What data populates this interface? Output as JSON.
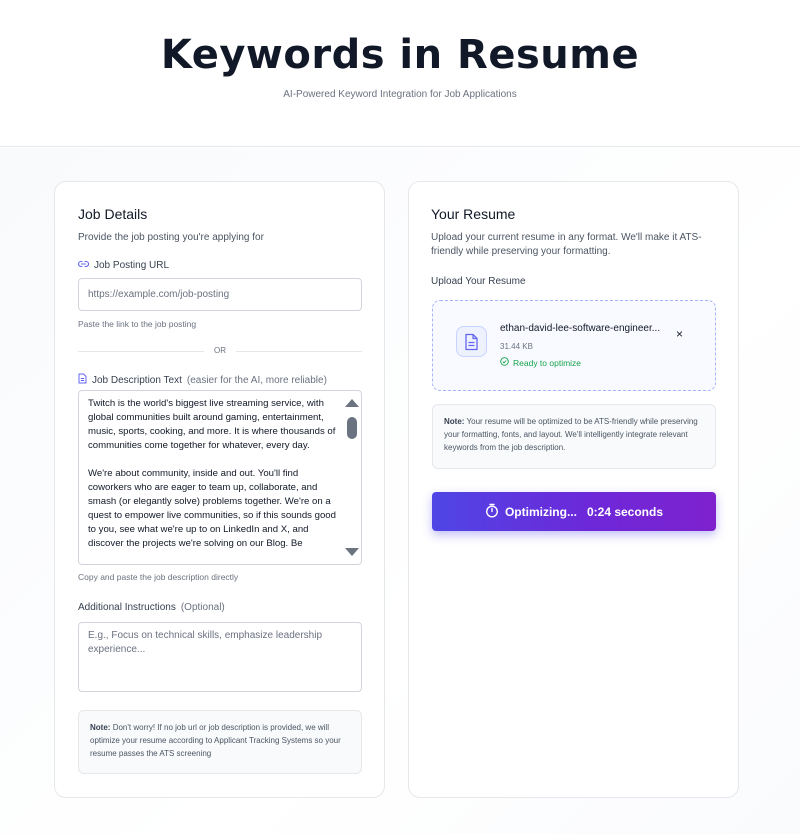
{
  "header": {
    "title": "Keywords in Resume",
    "subtitle": "AI-Powered Keyword Integration for Job Applications"
  },
  "job_details": {
    "title": "Job Details",
    "description": "Provide the job posting you're applying for",
    "url_label": "Job Posting URL",
    "url_placeholder": "https://example.com/job-posting",
    "url_value": "",
    "url_hint": "Paste the link to the job posting",
    "or_text": "OR",
    "jd_label": "Job Description Text",
    "jd_label_note": "(easier for the AI, more reliable)",
    "jd_value": "Twitch is the world's biggest live streaming service, with global communities built around gaming, entertainment, music, sports, cooking, and more. It is where thousands of communities come together for whatever, every day.\n\nWe're about community, inside and out. You'll find coworkers who are eager to team up, collaborate, and smash (or elegantly solve) problems together. We're on a quest to empower live communities, so if this sounds good to you, see what we're up to on LinkedIn and X, and discover the projects we're solving on our Blog. Be",
    "jd_hint": "Copy and paste the job description directly",
    "instructions_label": "Additional Instructions",
    "instructions_optional": "(Optional)",
    "instructions_placeholder": "E.g., Focus on technical skills, emphasize leadership experience...",
    "note_label": "Note:",
    "note_text": "Don't worry! If no job url or job description is provided, we will optimize your resume according to Applicant Tracking Systems so your resume passes the ATS screening"
  },
  "resume": {
    "title": "Your Resume",
    "description": "Upload your current resume in any format. We'll make it ATS-friendly while preserving your formatting.",
    "upload_label": "Upload Your Resume",
    "file": {
      "name": "ethan-david-lee-software-engineer...",
      "size": "31.44 KB",
      "status": "Ready to optimize",
      "remove_glyph": "×"
    },
    "note_label": "Note:",
    "note_text": "Your resume will be optimized to be ATS-friendly while preserving your formatting, fonts, and layout. We'll intelligently integrate relevant keywords from the job description.",
    "button": {
      "label": "Optimizing...",
      "time": "0:24 seconds"
    }
  },
  "colors": {
    "accent_start": "#4f46e5",
    "accent_end": "#7e22ce",
    "success": "#16a34a",
    "icon": "#6366f1"
  },
  "icons": [
    "link-icon",
    "document-icon",
    "file-icon",
    "check-circle-icon",
    "timer-icon",
    "close-icon"
  ]
}
